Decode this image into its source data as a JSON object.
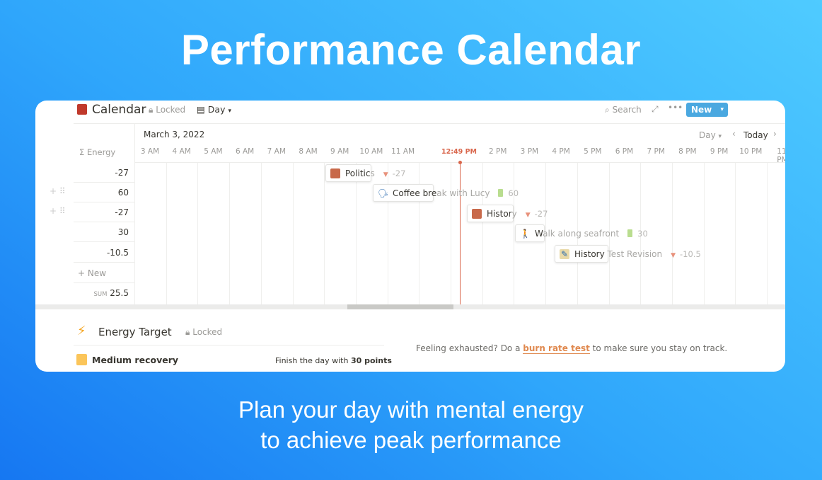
{
  "hero": {
    "title": "Performance Calendar",
    "subtitle_line1": "Plan your day with mental energy",
    "subtitle_line2": "to achieve peak performance"
  },
  "header": {
    "title": "Calendar",
    "locked": "Locked",
    "view": "Day",
    "search": "Search",
    "new_button": "New"
  },
  "timeline": {
    "date": "March 3, 2022",
    "view": "Day",
    "today": "Today",
    "current_time": "12:49 PM",
    "hours": [
      "3 AM",
      "4 AM",
      "5 AM",
      "6 AM",
      "7 AM",
      "8 AM",
      "9 AM",
      "10 AM",
      "11 AM",
      "2 PM",
      "3 PM",
      "4 PM",
      "5 PM",
      "6 PM",
      "7 PM",
      "8 PM",
      "9 PM",
      "10 PM",
      "11 PM"
    ]
  },
  "energy_column": {
    "header": "Energy",
    "values": [
      "-27",
      "60",
      "-27",
      "30",
      "-10.5"
    ],
    "new_label": "New",
    "sum_label": "SUM",
    "sum_value": "25.5"
  },
  "events": [
    {
      "name_visible": "Politic",
      "name_faded": "s",
      "energy": "-27",
      "type": "drain",
      "icon": "book-icon"
    },
    {
      "name_visible": "Coffee bre",
      "name_faded": "ak with Lucy",
      "energy": "60",
      "type": "recharge",
      "icon": "speaking-head-icon"
    },
    {
      "name_visible": "Histor",
      "name_faded": "y",
      "energy": "-27",
      "type": "drain",
      "icon": "book-icon"
    },
    {
      "name_visible": "W",
      "name_faded": "alk along seafront",
      "energy": "30",
      "type": "recharge",
      "icon": "walking-person-icon"
    },
    {
      "name_visible": "History",
      "name_faded": " Test Revision",
      "energy": "-10.5",
      "type": "drain",
      "icon": "memo-icon"
    }
  ],
  "energy_target": {
    "title": "Energy Target",
    "locked": "Locked",
    "level": "Medium recovery",
    "goal_prefix": "Finish the day with ",
    "goal_bold": "30 points",
    "tip_prefix": "Feeling exhausted? Do a ",
    "tip_link": "burn rate test",
    "tip_suffix": " to make sure you stay on track."
  },
  "colors": {
    "accent": "#4aa8e0",
    "current_time": "#d9654a",
    "link": "#e0894f",
    "medium_recovery": "#fbc55a"
  }
}
